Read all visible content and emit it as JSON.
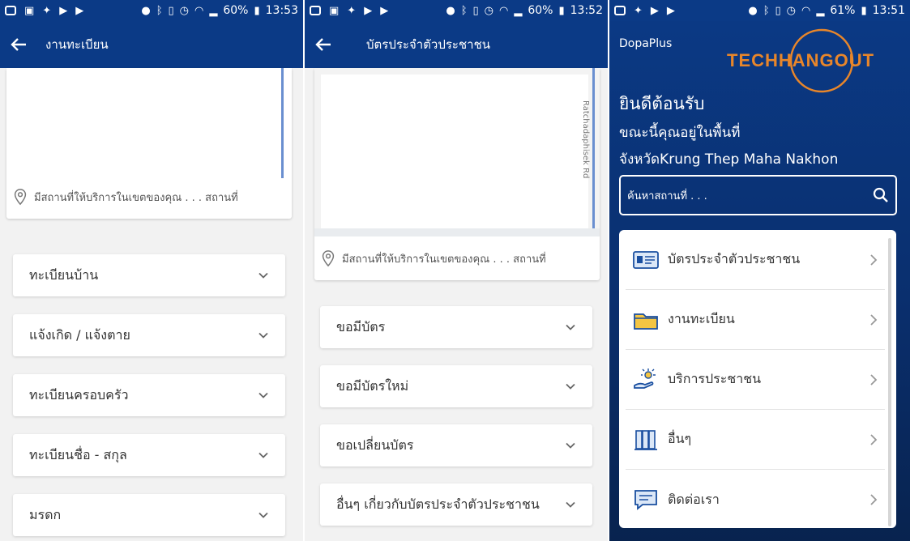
{
  "panel1": {
    "status": {
      "battery": "60%",
      "time": "13:53"
    },
    "appbar": {
      "title": "งานทะเบียน"
    },
    "map": {
      "places_text": "มีสถานที่ให้บริการในเขตของคุณ . . . สถานที่"
    },
    "accordion": [
      {
        "label": "ทะเบียนบ้าน"
      },
      {
        "label": "แจ้งเกิด / แจ้งตาย"
      },
      {
        "label": "ทะเบียนครอบครัว"
      },
      {
        "label": "ทะเบียนชื่อ - สกุล"
      },
      {
        "label": "มรดก"
      }
    ]
  },
  "panel2": {
    "status": {
      "battery": "60%",
      "time": "13:52"
    },
    "appbar": {
      "title": "บัตรประจำตัวประชาชน"
    },
    "map": {
      "road_label": "Ratchadaphisek Rd",
      "places_text": "มีสถานที่ให้บริการในเขตของคุณ . . . สถานที่"
    },
    "accordion": [
      {
        "label": "ขอมีบัตร"
      },
      {
        "label": "ขอมีบัตรใหม่"
      },
      {
        "label": "ขอเปลี่ยนบัตร"
      },
      {
        "label": "อื่นๆ เกี่ยวกับบัตรประจำตัวประชาชน"
      }
    ]
  },
  "panel3": {
    "status": {
      "battery": "61%",
      "time": "13:51"
    },
    "app_name": "DopaPlus",
    "logo_text": "TECHHANGOUT",
    "welcome": {
      "line1": "ยินดีต้อนรับ",
      "line2": "ขณะนี้คุณอยู่ในพื้นที่",
      "line3": "จังหวัดKrung Thep Maha Nakhon"
    },
    "search": {
      "placeholder": "ค้นหาสถานที่ . . ."
    },
    "menu": [
      {
        "label": "บัตรประจำตัวประชาชน",
        "icon": "id-card-icon"
      },
      {
        "label": "งานทะเบียน",
        "icon": "folder-icon"
      },
      {
        "label": "บริการประชาชน",
        "icon": "service-hand-icon"
      },
      {
        "label": "อื่นๆ",
        "icon": "cabinet-icon"
      },
      {
        "label": "ติดต่อเรา",
        "icon": "chat-icon"
      }
    ]
  },
  "colors": {
    "primary": "#0b3a86",
    "logo_orange": "#e8862a",
    "background": "#f2f2f2"
  }
}
